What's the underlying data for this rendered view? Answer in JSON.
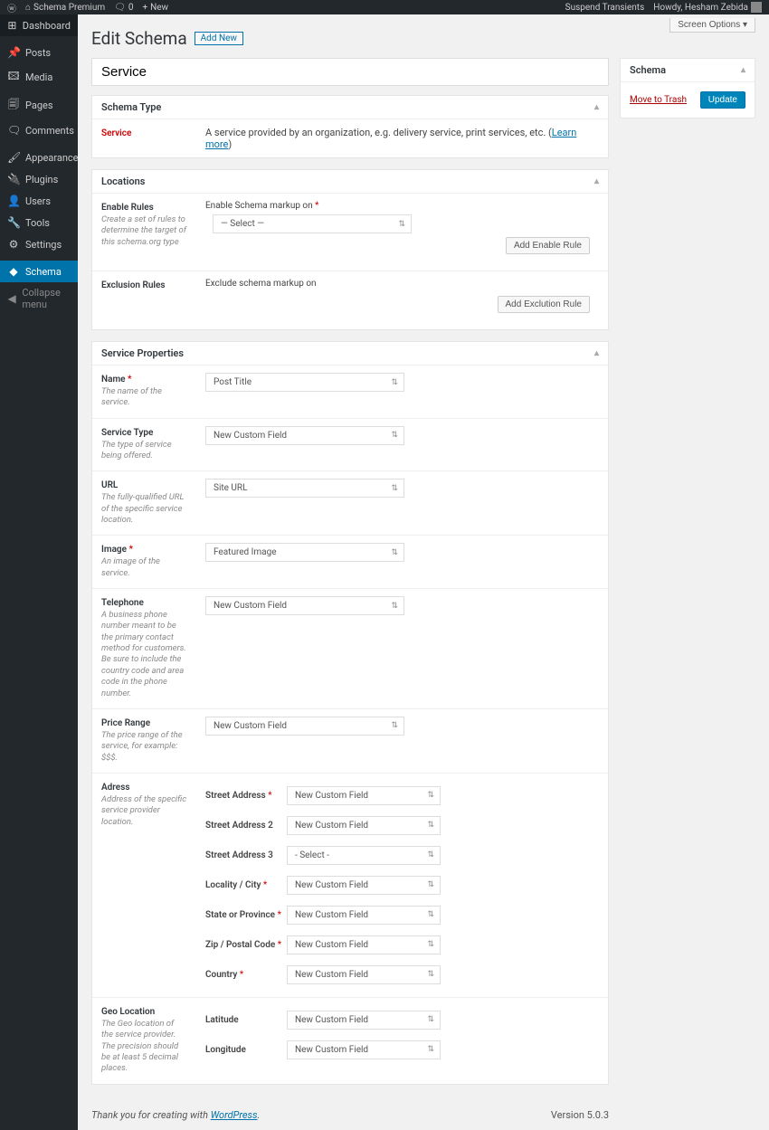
{
  "adminbar": {
    "site_name": "Schema Premium",
    "comments_count": "0",
    "new_label": "New",
    "suspend_transients": "Suspend Transients",
    "howdy": "Howdy, Hesham Zebida"
  },
  "sidebar": {
    "dashboard": "Dashboard",
    "posts": "Posts",
    "media": "Media",
    "pages": "Pages",
    "comments": "Comments",
    "appearance": "Appearance",
    "plugins": "Plugins",
    "users": "Users",
    "tools": "Tools",
    "settings": "Settings",
    "schema": "Schema",
    "collapse": "Collapse menu"
  },
  "screen_options": "Screen Options ▾",
  "page_title": "Edit Schema",
  "add_new": "Add New",
  "title_value": "Service",
  "schema_type": {
    "header": "Schema Type",
    "label": "Service",
    "desc": "A service provided by an organization, e.g. delivery service, print services, etc. (",
    "learn_more": "Learn more",
    "desc_end": ")"
  },
  "locations": {
    "header": "Locations",
    "enable_rules": "Enable Rules",
    "enable_rules_desc": "Create a set of rules to determine the target of this schema.org type",
    "enable_on": "Enable Schema markup on",
    "select": "— Select —",
    "add_enable": "Add Enable Rule",
    "exclusion_rules": "Exclusion Rules",
    "exclude_on": "Exclude schema markup on",
    "add_exclusion": "Add Exclution Rule"
  },
  "props": {
    "header": "Service Properties",
    "name": {
      "label": "Name",
      "desc": "The name of the service.",
      "value": "Post Title"
    },
    "service_type": {
      "label": "Service Type",
      "desc": "The type of service being offered.",
      "value": "New Custom Field"
    },
    "url": {
      "label": "URL",
      "desc": "The fully-qualified URL of the specific service location.",
      "value": "Site URL"
    },
    "image": {
      "label": "Image",
      "desc": "An image of the service.",
      "value": "Featured Image"
    },
    "telephone": {
      "label": "Telephone",
      "desc": "A business phone number meant to be the primary contact method for customers. Be sure to include the country code and area code in the phone number.",
      "value": "New Custom Field"
    },
    "price": {
      "label": "Price Range",
      "desc": "The price range of the service, for example: $$$.",
      "value": "New Custom Field"
    },
    "address": {
      "label": "Adress",
      "desc": "Address of the specific service provider location.",
      "street": {
        "label": "Street Address",
        "value": "New Custom Field"
      },
      "street2": {
        "label": "Street Address 2",
        "value": "New Custom Field"
      },
      "street3": {
        "label": "Street Address 3",
        "value": "- Select -"
      },
      "city": {
        "label": "Locality / City",
        "value": "New Custom Field"
      },
      "state": {
        "label": "State or Province",
        "value": "New Custom Field"
      },
      "zip": {
        "label": "Zip / Postal Code",
        "value": "New Custom Field"
      },
      "country": {
        "label": "Country",
        "value": "New Custom Field"
      }
    },
    "geo": {
      "label": "Geo Location",
      "desc": "The Geo location of the service provider. The precision should be at least 5 decimal places.",
      "lat": {
        "label": "Latitude",
        "value": "New Custom Field"
      },
      "lng": {
        "label": "Longitude",
        "value": "New Custom Field"
      }
    }
  },
  "sidebox": {
    "header": "Schema",
    "trash": "Move to Trash",
    "update": "Update"
  },
  "footer": {
    "thank_you": "Thank you for creating with ",
    "wordpress": "WordPress",
    "version": "Version 5.0.3"
  }
}
